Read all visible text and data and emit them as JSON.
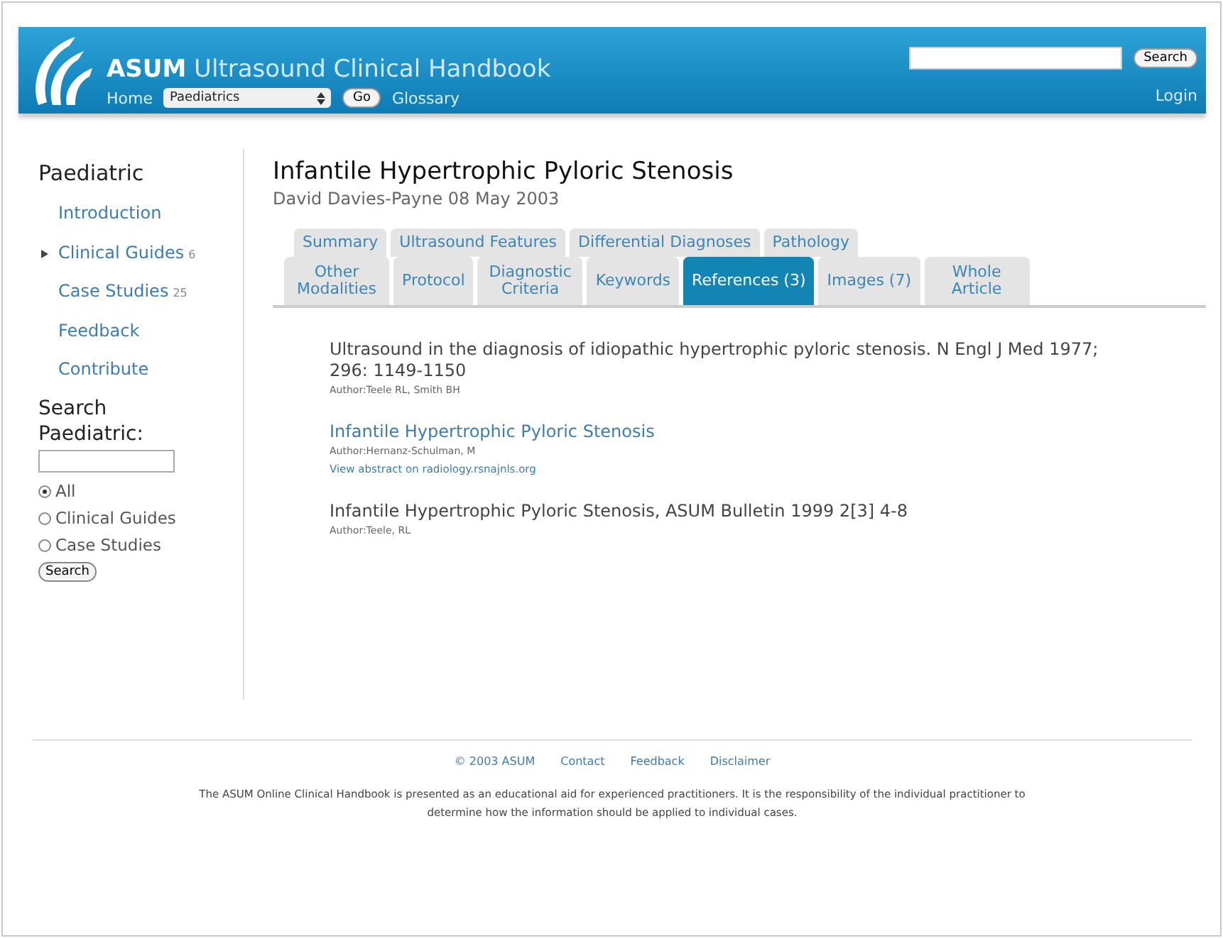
{
  "header": {
    "brand_bold": "ASUM",
    "brand_rest": "Ultrasound Clinical Handbook",
    "search_button": "Search",
    "nav": {
      "home": "Home",
      "section_select": "Paediatrics",
      "go_button": "Go",
      "glossary": "Glossary",
      "login": "Login"
    }
  },
  "sidebar": {
    "title": "Paediatric",
    "groups": [
      [
        {
          "label": "Introduction",
          "current": false
        }
      ],
      [
        {
          "label": "Clinical Guides",
          "count": "6",
          "current": true
        },
        {
          "label": "Case Studies",
          "count": "25",
          "current": false
        }
      ],
      [
        {
          "label": "Feedback",
          "current": false
        },
        {
          "label": "Contribute",
          "current": false
        }
      ]
    ],
    "search": {
      "title": "Search Paediatric:",
      "options": [
        {
          "label": "All",
          "selected": true
        },
        {
          "label": "Clinical Guides",
          "selected": false
        },
        {
          "label": "Case Studies",
          "selected": false
        }
      ],
      "button": "Search"
    }
  },
  "article": {
    "title": "Infantile Hypertrophic Pyloric Stenosis",
    "byline": "David Davies-Payne  08 May 2003",
    "tab_rows": [
      [
        {
          "label": "Summary",
          "selected": false
        },
        {
          "label": "Ultrasound Features",
          "selected": false
        },
        {
          "label": "Differential Diagnoses",
          "selected": false
        },
        {
          "label": "Pathology",
          "selected": false
        }
      ],
      [
        {
          "label": "Other Modalities",
          "selected": false
        },
        {
          "label": "Protocol",
          "selected": false
        },
        {
          "label": "Diagnostic Criteria",
          "selected": false
        },
        {
          "label": "Keywords",
          "selected": false
        },
        {
          "label": "References (3)",
          "selected": true
        },
        {
          "label": "Images (7)",
          "selected": false
        },
        {
          "label": "Whole Article",
          "selected": false
        }
      ]
    ],
    "references": [
      {
        "kind": "plain",
        "title": "Ultrasound in the diagnosis of idiopathic hypertrophic pyloric stenosis. N Engl J Med 1977; 296: 1149-1150",
        "authors": "Author:Teele RL, Smith BH"
      },
      {
        "kind": "link",
        "title": "Infantile Hypertrophic Pyloric Stenosis",
        "authors": "Author:Hernanz-Schulman, M",
        "abstract": "View abstract on radiology.rsnajnls.org"
      },
      {
        "kind": "plain",
        "title": "Infantile Hypertrophic Pyloric Stenosis, ASUM Bulletin 1999 2[3] 4-8",
        "authors": "Author:Teele, RL"
      }
    ]
  },
  "footer": {
    "links": [
      "© 2003 ASUM",
      "Contact",
      "Feedback",
      "Disclaimer"
    ],
    "notice": "The ASUM Online Clinical Handbook is presented as an educational aid for experienced practitioners. It is the responsibility of the individual practitioner to determine how the information should be applied to individual cases."
  }
}
